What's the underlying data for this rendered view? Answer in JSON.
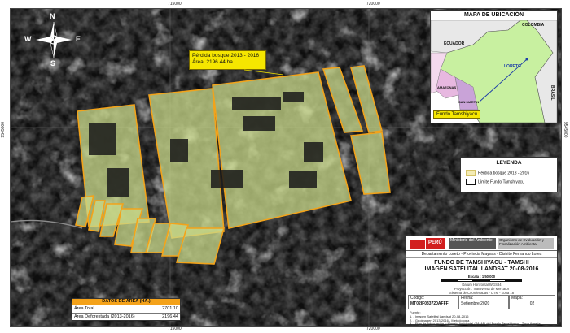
{
  "colors": {
    "outline": "#f2a31b",
    "forest_loss": "#c9d98a",
    "imagery": "#0b0b0b",
    "callout_bg": "#f5e600",
    "table_header": "#f4a21a",
    "peru_red": "#d21f1f"
  },
  "coords": {
    "top": [
      "715000",
      "720000"
    ],
    "bottom": [
      "715000",
      "720000"
    ],
    "left": "9545000",
    "right": "9545000"
  },
  "compass": {
    "n": "N",
    "s": "S",
    "e": "E",
    "w": "W"
  },
  "callout": {
    "line1": "Pérdida bosque 2013 - 2016",
    "line2": "Área: 2196.44 ha."
  },
  "location_map": {
    "title": "MAPA DE UBICACIÓN",
    "labels": {
      "colombia": "COLOMBIA",
      "ecuador": "ECUADOR",
      "brasil": "BRASIL",
      "loreto": "LORETO",
      "amazonas": "AMAZONAS",
      "san_martin": "SAN MARTIN"
    },
    "fundo_label": "Fundo Tamshiyacu"
  },
  "legend": {
    "title": "LEYENDA",
    "items": [
      "Pérdida bosque 2013 - 2016",
      "Límite Fundo Tamshiyacu"
    ]
  },
  "cartouche": {
    "peru": "PERÚ",
    "ministry": "Ministerio del Ambiente",
    "org": "Organismo de Evaluación y Fiscalización Ambiental",
    "location": "Departamento Loreto - Provincia Maynas - Distrito Fernando Lores",
    "title1": "FUNDO DE TAMSHIYACU - TAMSHI",
    "title2": "IMAGEN SATELITAL LANDSAT 20-08-2016",
    "scale": "Escala : 1/50 000",
    "datum": "Datum Horizontal WGS84",
    "projection": "Proyección: Transversa de Mercator",
    "system": "Sistema de Coordenadas - UTM - Zona 18",
    "codigo_label": "Código:",
    "codigo": "MT02IF033720AFFF",
    "fecha_label": "Fecha:",
    "fecha": "Setiembre 2020",
    "mapa_label": "Mapa:",
    "mapa": "02",
    "fuente_label": "Fuente:",
    "notes": [
      "1. - Imagen Satelital Landsat 20-08-2016",
      "2. - Geoimagen 2013-2016 - Metodología",
      "3. - Plan de Adecuación y Manejo Ambiental (PAMA) del Fundo Tamshiyacu - Zona Agraria"
    ]
  },
  "area_table": {
    "header": "DATOS DE ÁREA (HA.)",
    "rows": [
      {
        "label": "Área Total",
        "value": "2701.10"
      },
      {
        "label": "Área Deforestada (2013-2016)",
        "value": "2196.44"
      }
    ]
  }
}
